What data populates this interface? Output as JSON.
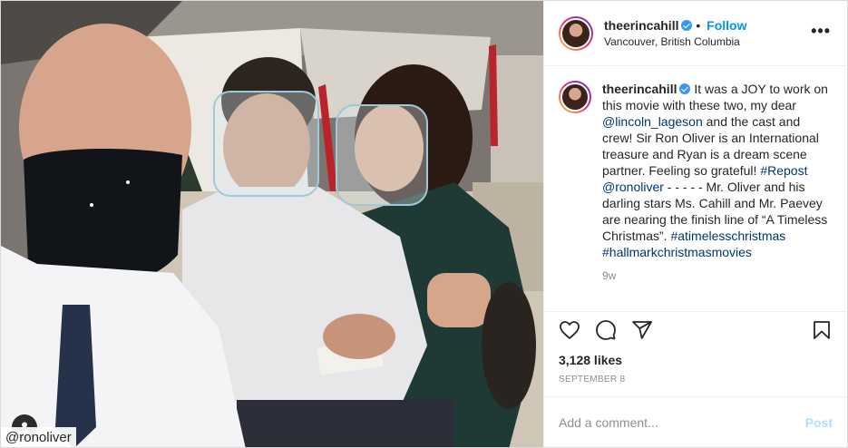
{
  "post": {
    "username": "theerincahill",
    "follow_label": "Follow",
    "location": "Vancouver, British Columbia",
    "more_icon": "•••",
    "caption_parts": [
      {
        "text": "It was a JOY to work on this movie with these two, my dear ",
        "link": false
      },
      {
        "text": "@lincoln_lageson",
        "link": true
      },
      {
        "text": " and the cast and crew! Sir Ron Oliver is an International treasure and Ryan is a dream scene partner. Feeling so grateful! ",
        "link": false
      },
      {
        "text": "#Repost",
        "link": true
      },
      {
        "text": " ",
        "link": false
      },
      {
        "text": "@ronoliver",
        "link": true
      },
      {
        "text": " - - - - - Mr. Oliver and his darling stars Ms. Cahill and Mr. Paevey are nearing the finish line of “A Timeless Christmas”. ",
        "link": false
      },
      {
        "text": "#atimelesschristmas",
        "link": true
      },
      {
        "text": " ",
        "link": false
      },
      {
        "text": "#hallmarkchristmasmovies",
        "link": true
      }
    ],
    "age": "9w",
    "likes": "3,128 likes",
    "date": "SEPTEMBER 8",
    "comment_placeholder": "Add a comment...",
    "post_label": "Post",
    "photo_tag": "@ronoliver",
    "icons": [
      "heart-icon",
      "comment-icon",
      "share-icon",
      "bookmark-icon",
      "user-tag-icon",
      "verified-icon"
    ],
    "colors": {
      "accent": "#0095f6",
      "link": "#00376b",
      "muted": "#8e8e8e",
      "post_disabled": "#b2dffc"
    }
  }
}
